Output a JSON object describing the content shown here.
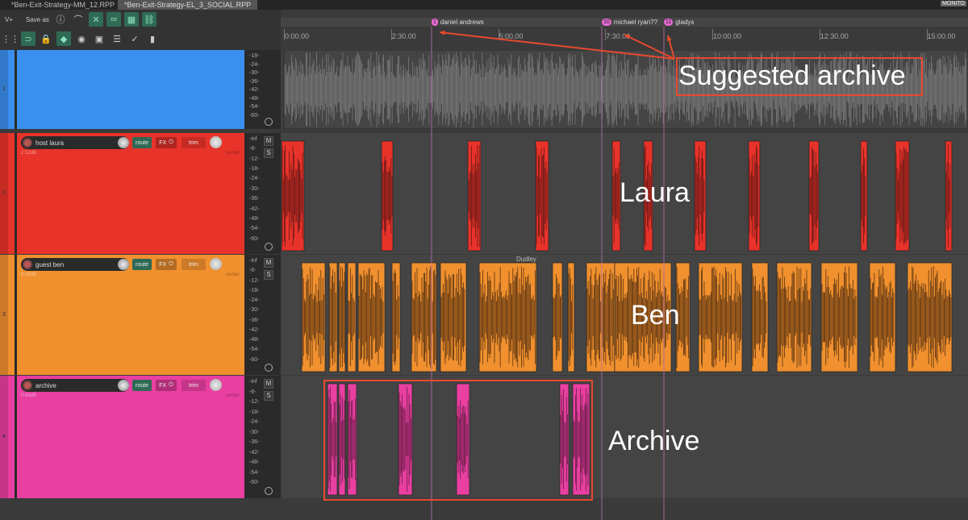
{
  "tabs": [
    {
      "label": "*Ben-Exit-Strategy-MM_12.RPP"
    },
    {
      "label": "*Ben-Exit-Strategy-EL_3_SOCIAL.RPP"
    }
  ],
  "monitor_label": "MONITO",
  "toolbar": {
    "version_label": "V+",
    "save_as_label": "Save as",
    "icons": [
      "info-icon",
      "curve-icon",
      "crossfade-icon",
      "link-icon",
      "grid-icon",
      "group-link-icon",
      "grid-dots-icon",
      "snap-icon",
      "lock-icon",
      "ripple-icon",
      "envelope-eye-icon",
      "media-icon",
      "track-list-icon",
      "eye-check-icon",
      "meter-bars-icon"
    ]
  },
  "ruler": {
    "ticks": [
      "0:00.00",
      "2:30.00",
      "5:00.00",
      "7:30.00",
      "10:00.00",
      "12:30.00",
      "15:00.00"
    ]
  },
  "markers": [
    {
      "num": "1",
      "name": "daniel andrews"
    },
    {
      "num": "10",
      "name": "michael ryan??"
    },
    {
      "num": "11",
      "name": "gladys"
    }
  ],
  "meter_scale": [
    "-18-",
    "-24-",
    "-30-",
    "-36-",
    "-42-",
    "-48-",
    "-54-",
    "-60-"
  ],
  "meter_scale_full": [
    "-inf",
    "-6-",
    "-12-",
    "-18-",
    "-24-",
    "-30-",
    "-36-",
    "-42-",
    "-48-",
    "-54-",
    "-60-"
  ],
  "tracks": [
    {
      "num": "1",
      "name": "",
      "volume": "",
      "pan": "",
      "color": "#3b8fee"
    },
    {
      "num": "2",
      "name": "host laura",
      "volume": "2.52dB",
      "pan": "center",
      "color": "#e8332a"
    },
    {
      "num": "3",
      "name": "guest ben",
      "volume": "0.00dB",
      "pan": "center",
      "color": "#f0902e"
    },
    {
      "num": "4",
      "name": "archive",
      "volume": "0.00dB",
      "pan": "center",
      "color": "#e83fa0"
    }
  ],
  "buttons": {
    "route": "route",
    "fx": "FX",
    "trim": "trim",
    "mute": "M",
    "solo": "S"
  },
  "item_label": "Dudley",
  "annotations": {
    "suggested": "Suggested archive",
    "laura": "Laura",
    "ben": "Ben",
    "archive": "Archive"
  },
  "colors": {
    "annotation": "#e8492f",
    "marker": "#e86ad4"
  }
}
